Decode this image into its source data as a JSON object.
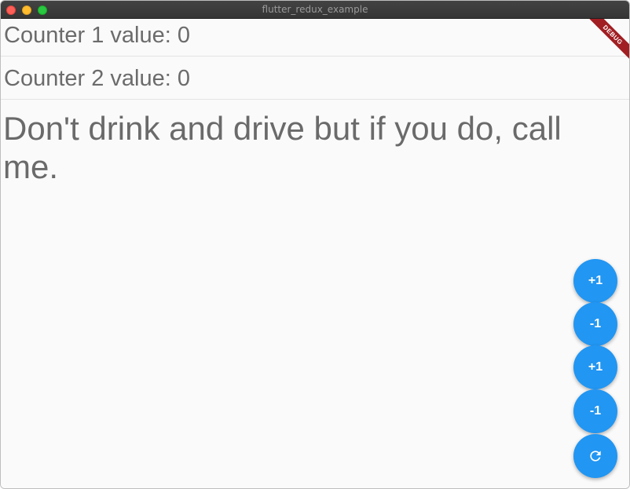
{
  "window": {
    "title": "flutter_redux_example"
  },
  "counters": [
    {
      "label": "Counter 1 value: 0"
    },
    {
      "label": "Counter 2 value: 0"
    }
  ],
  "joke": "Don't drink and drive but if you do, call me.",
  "debug_banner": "DEBUG",
  "fabs": [
    {
      "label": "+1"
    },
    {
      "label": "-1"
    },
    {
      "label": "+1"
    },
    {
      "label": "-1"
    }
  ],
  "reset_icon": "refresh-icon",
  "colors": {
    "fab": "#2196f3",
    "text": "#6b6b6b",
    "banner": "#a11e22"
  }
}
